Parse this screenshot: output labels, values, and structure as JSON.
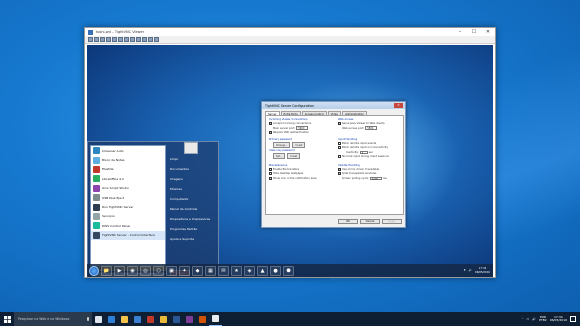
{
  "host": {
    "taskbar": {
      "search_placeholder": "Pesquisar na Web e no Windows",
      "language": {
        "line1": "POR",
        "line2": "PTB2"
      },
      "clock": {
        "time": "17:34",
        "date": "06/05/2016"
      },
      "icons": [
        {
          "name": "task-view-icon",
          "color": "#dfe6ee"
        },
        {
          "name": "edge-icon",
          "color": "#2e7fd6"
        },
        {
          "name": "file-explorer-icon",
          "color": "#f2c24a"
        },
        {
          "name": "store-icon",
          "color": "#3a7fd1"
        },
        {
          "name": "filezilla-icon",
          "color": "#c0392b"
        },
        {
          "name": "chrome-icon",
          "color": "#e9b93a"
        },
        {
          "name": "word-icon",
          "color": "#2b5797"
        },
        {
          "name": "app-icon",
          "color": "#7d3c98"
        },
        {
          "name": "paint-icon",
          "color": "#d35400"
        },
        {
          "name": "tightvnc-viewer-icon",
          "color": "#e8ecf1",
          "open": true
        }
      ]
    }
  },
  "viewer": {
    "title": "toshi-wd – TightVNC Viewer"
  },
  "dialog": {
    "title": "TightVNC Server Configuration",
    "tabs": [
      "Server",
      "Extra Ports",
      "Access Control",
      "Video",
      "Administration"
    ],
    "incoming": {
      "title": "Incoming Viewer Connections",
      "accept": "Accept incoming connections",
      "main_port_label": "Main server port:",
      "main_port": "5900",
      "require_auth": "Require VNC authentication"
    },
    "primary_password": {
      "title": "Primary password",
      "change": "Change...",
      "unset": "Unset"
    },
    "view_only_password": {
      "title": "View-only password",
      "set": "Set...",
      "unset": "Unset"
    },
    "misc": {
      "title": "Miscellaneous",
      "file_transfers": "Enable file transfers",
      "hide_wallpaper": "Hide desktop wallpaper",
      "show_icon": "Show icon in the notification area"
    },
    "web_access": {
      "title": "Web Access",
      "serve_java": "Serve Java Viewer to Web clients",
      "web_port_label": "Web access port:",
      "web_port": "5800"
    },
    "input": {
      "title": "Input Handling",
      "block_remote": "Block remote input events",
      "block_activity": "Block remote input on local activity",
      "inactivity_label": "Inactivity:",
      "inactivity": "3",
      "inactivity_unit": "sec",
      "no_local": "No local input during client sessions"
    },
    "update": {
      "title": "Update Handling",
      "mirror_driver": "Use mirror driver if available",
      "grab_transparent": "Grab transparent windows",
      "polling_label": "Screen polling cycle:",
      "polling": "1000",
      "polling_unit": "ms"
    },
    "buttons": {
      "ok": "OK",
      "cancel": "Cancel",
      "apply": "Apply"
    }
  },
  "start_menu": {
    "programs": [
      {
        "label": "CCleaner Auto",
        "color": "#2e86c1"
      },
      {
        "label": "Bloco de Notas",
        "color": "#5dade2"
      },
      {
        "label": "FileZilla",
        "color": "#c0392b"
      },
      {
        "label": "LibreOffice 4.2",
        "color": "#27ae60"
      },
      {
        "label": "Unix Script Studio",
        "color": "#8e44ad"
      },
      {
        "label": "USB Disk Eject",
        "color": "#7f8c8d"
      },
      {
        "label": "Run TightVNC Server",
        "color": "#2c3e50"
      },
      {
        "label": "Serviços",
        "color": "#95a5a6"
      },
      {
        "label": "DWS Control Panel",
        "color": "#1abc9c"
      },
      {
        "label": "TightVNC Server - Control Interface",
        "color": "#34495e",
        "selected": true
      }
    ],
    "all_programs": "Todos os Programas",
    "search_placeholder": "Pesquisar programas e arquivos",
    "right_items": [
      "Limpr",
      "Documentos",
      "Imagens",
      "Músicas",
      "Computador",
      "Painel de Controle",
      "Dispositivos e Impressoras",
      "Programas Padrão",
      "Ajuda e Suporte"
    ],
    "power": "Desligar"
  },
  "remote_taskbar": {
    "icons": [
      "📁",
      "▶",
      "◉",
      "◎",
      "⬡",
      "▣",
      "✦",
      "◆",
      "▦",
      "✉",
      "★",
      "◈",
      "▲",
      "●",
      "⬣"
    ],
    "clock": {
      "time": "17:34",
      "date": "06/05/2016"
    }
  }
}
